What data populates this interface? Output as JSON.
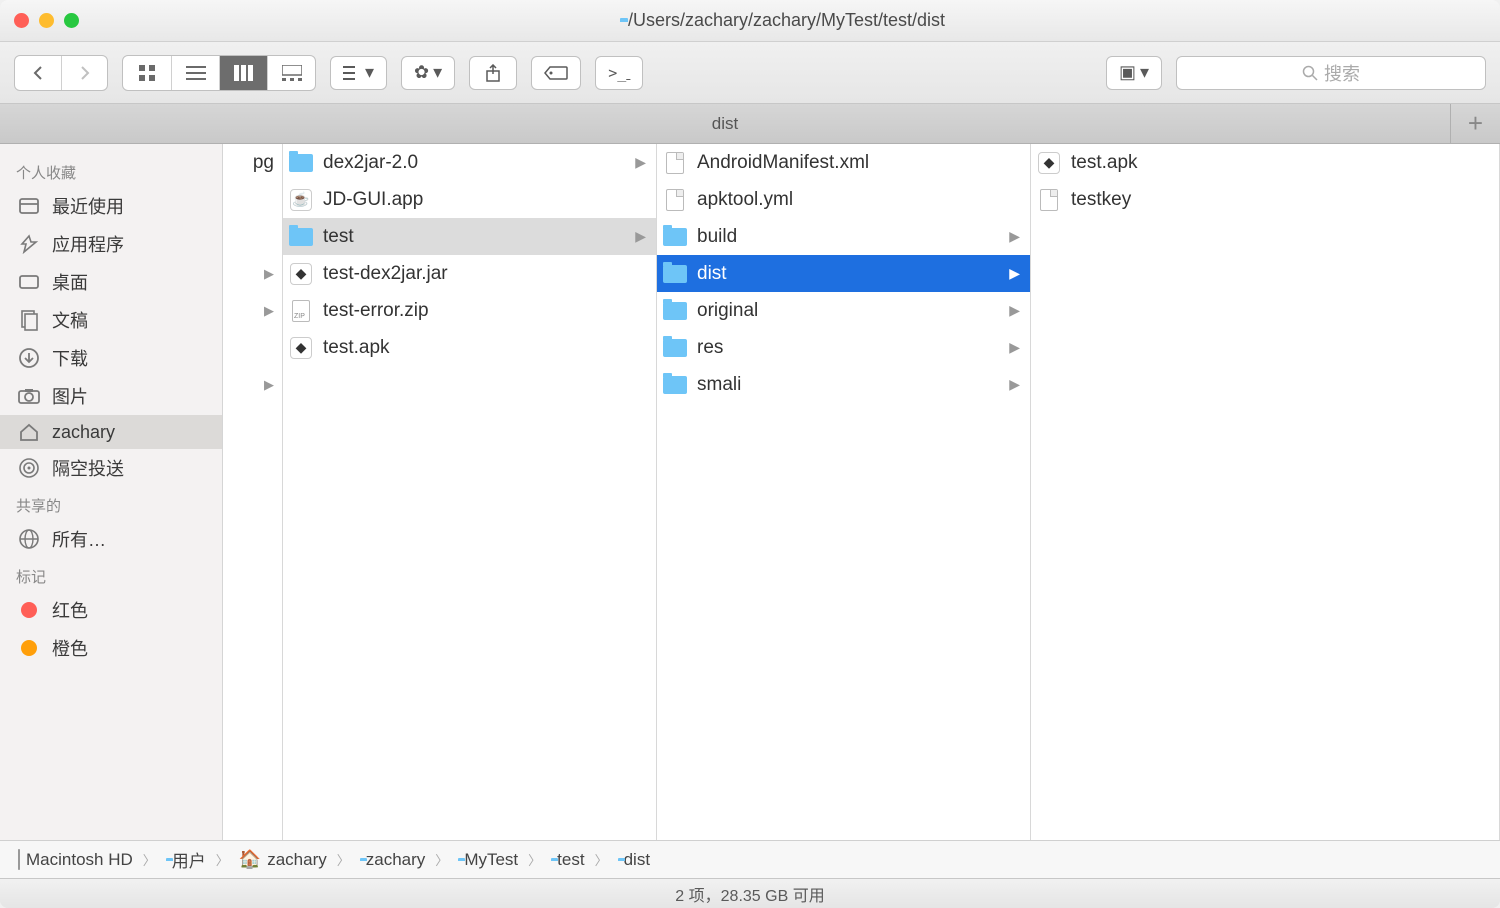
{
  "window": {
    "path_title": "/Users/zachary/zachary/MyTest/test/dist"
  },
  "search": {
    "placeholder": "搜索"
  },
  "tab": {
    "label": "dist"
  },
  "sidebar": {
    "sections": [
      {
        "header": "个人收藏",
        "items": [
          {
            "icon": "recent",
            "label": "最近使用"
          },
          {
            "icon": "apps",
            "label": "应用程序"
          },
          {
            "icon": "desktop",
            "label": "桌面"
          },
          {
            "icon": "documents",
            "label": "文稿"
          },
          {
            "icon": "downloads",
            "label": "下载"
          },
          {
            "icon": "pictures",
            "label": "图片"
          },
          {
            "icon": "home",
            "label": "zachary",
            "active": true
          },
          {
            "icon": "airdrop",
            "label": "隔空投送"
          }
        ]
      },
      {
        "header": "共享的",
        "items": [
          {
            "icon": "globe",
            "label": "所有…"
          }
        ]
      },
      {
        "header": "标记",
        "items": [
          {
            "icon": "tag",
            "color": "#ff5f57",
            "label": "红色"
          },
          {
            "icon": "tag",
            "color": "#ff9f0a",
            "label": "橙色"
          }
        ]
      }
    ]
  },
  "columns": {
    "peek": [
      {
        "text": "pg",
        "chev": false
      },
      {
        "text": "",
        "chev": true
      },
      {
        "text": "",
        "chev": true
      },
      {
        "text": "",
        "chev": true
      }
    ],
    "col1": [
      {
        "icon": "folder",
        "label": "dex2jar-2.0",
        "chev": true
      },
      {
        "icon": "app",
        "label": "JD-GUI.app"
      },
      {
        "icon": "folder",
        "label": "test",
        "chev": true,
        "selgrey": true
      },
      {
        "icon": "app",
        "label": "test-dex2jar.jar"
      },
      {
        "icon": "zip",
        "label": "test-error.zip"
      },
      {
        "icon": "app",
        "label": "test.apk"
      }
    ],
    "col2": [
      {
        "icon": "doc",
        "label": "AndroidManifest.xml"
      },
      {
        "icon": "doc",
        "label": "apktool.yml"
      },
      {
        "icon": "folder",
        "label": "build",
        "chev": true
      },
      {
        "icon": "folder",
        "label": "dist",
        "chev": true,
        "sel": true
      },
      {
        "icon": "folder",
        "label": "original",
        "chev": true
      },
      {
        "icon": "folder",
        "label": "res",
        "chev": true
      },
      {
        "icon": "folder",
        "label": "smali",
        "chev": true
      }
    ],
    "col3": [
      {
        "icon": "app",
        "label": "test.apk"
      },
      {
        "icon": "doc",
        "label": "testkey"
      }
    ]
  },
  "pathbar": [
    {
      "icon": "hd",
      "label": "Macintosh HD"
    },
    {
      "icon": "folder",
      "label": "用户"
    },
    {
      "icon": "home",
      "label": "zachary"
    },
    {
      "icon": "folder",
      "label": "zachary"
    },
    {
      "icon": "folder",
      "label": "MyTest"
    },
    {
      "icon": "folder",
      "label": "test"
    },
    {
      "icon": "folder",
      "label": "dist"
    }
  ],
  "status": {
    "text": "2 项，28.35 GB 可用"
  }
}
